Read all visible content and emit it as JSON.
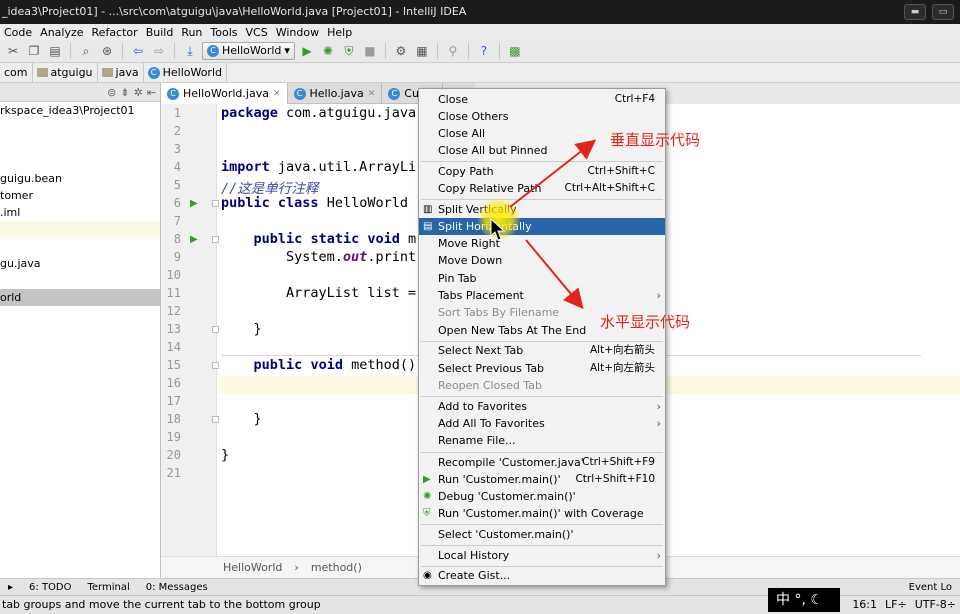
{
  "window": {
    "title": "_idea3\\Project01] - ...\\src\\com\\atguigu\\java\\HelloWorld.java [Project01] - IntelliJ IDEA"
  },
  "menubar": [
    "Code",
    "Analyze",
    "Refactor",
    "Build",
    "Run",
    "Tools",
    "VCS",
    "Window",
    "Help"
  ],
  "toolbar": {
    "run_config": "HelloWorld"
  },
  "navbar": {
    "crumbs": [
      "com",
      "atguigu",
      "java",
      "HelloWorld"
    ]
  },
  "project_tree": [
    "rkspace_idea3\\Project01",
    "",
    "",
    "",
    "guigu.bean",
    "tomer",
    ".iml",
    "",
    "",
    "gu.java",
    "",
    "orld"
  ],
  "tabs": [
    {
      "label": "HelloWorld.java"
    },
    {
      "label": "Hello.java"
    },
    {
      "label": "Custo"
    }
  ],
  "editor": {
    "line_numbers": [
      "1",
      "2",
      "3",
      "4",
      "5",
      "6",
      "7",
      "8",
      "9",
      "10",
      "11",
      "12",
      "13",
      "14",
      "15",
      "16",
      "17",
      "18",
      "19",
      "20",
      "21"
    ],
    "code": {
      "l1": "package com.atguigu.java",
      "l4": "import java.util.ArrayLi",
      "l5": "//这是单行注释",
      "l6": "public class HelloWorld ",
      "l8": "    public static void m",
      "l9a": "        System.",
      "l9b": "out",
      "l9c": ".print",
      "l11": "        ArrayList list =",
      "l13": "    }",
      "l15": "    public void method()",
      "l18": "    }",
      "l20": "}"
    },
    "breadcrumb": [
      "HelloWorld",
      "method()"
    ]
  },
  "context_menu": {
    "items": [
      {
        "label": "Close",
        "shortcut": "Ctrl+F4"
      },
      {
        "label": "Close Others",
        "shortcut": ""
      },
      {
        "label": "Close All",
        "shortcut": ""
      },
      {
        "label": "Close All but Pinned",
        "shortcut": ""
      },
      {
        "label": "Copy Path",
        "shortcut": "Ctrl+Shift+C"
      },
      {
        "label": "Copy Relative Path",
        "shortcut": "Ctrl+Alt+Shift+C"
      },
      {
        "label": "Split Vertically",
        "shortcut": ""
      },
      {
        "label": "Split Horizontally",
        "shortcut": ""
      },
      {
        "label": "Move Right",
        "shortcut": ""
      },
      {
        "label": "Move Down",
        "shortcut": ""
      },
      {
        "label": "Pin Tab",
        "shortcut": ""
      },
      {
        "label": "Tabs Placement",
        "shortcut": ""
      },
      {
        "label": "Sort Tabs By Filename",
        "shortcut": ""
      },
      {
        "label": "Open New Tabs At The End",
        "shortcut": ""
      },
      {
        "label": "Select Next Tab",
        "shortcut": "Alt+向右箭头"
      },
      {
        "label": "Select Previous Tab",
        "shortcut": "Alt+向左箭头"
      },
      {
        "label": "Reopen Closed Tab",
        "shortcut": ""
      },
      {
        "label": "Add to Favorites",
        "shortcut": ""
      },
      {
        "label": "Add All To Favorites",
        "shortcut": ""
      },
      {
        "label": "Rename File...",
        "shortcut": ""
      },
      {
        "label": "Recompile 'Customer.java'",
        "shortcut": "Ctrl+Shift+F9"
      },
      {
        "label": "Run 'Customer.main()'",
        "shortcut": "Ctrl+Shift+F10"
      },
      {
        "label": "Debug 'Customer.main()'",
        "shortcut": ""
      },
      {
        "label": "Run 'Customer.main()' with Coverage",
        "shortcut": ""
      },
      {
        "label": "Select 'Customer.main()'",
        "shortcut": ""
      },
      {
        "label": "Local History",
        "shortcut": ""
      },
      {
        "label": "Create Gist...",
        "shortcut": ""
      }
    ]
  },
  "annotations": {
    "vertical": "垂直显示代码",
    "horizontal": "水平显示代码"
  },
  "tool_windows": [
    "6: TODO",
    "Terminal",
    "0: Messages",
    "Event Lo"
  ],
  "statusbar": {
    "message": "tab groups and move the current tab to the bottom group",
    "position": "16:1",
    "line_sep": "LF÷",
    "encoding": "UTF-8÷"
  },
  "ime": {
    "label": "中 °, ☾"
  },
  "colors": {
    "menu_highlight": "#2865a8",
    "annotation": "#e0251d",
    "keyword": "#000080",
    "comment": "#3a48a8"
  }
}
